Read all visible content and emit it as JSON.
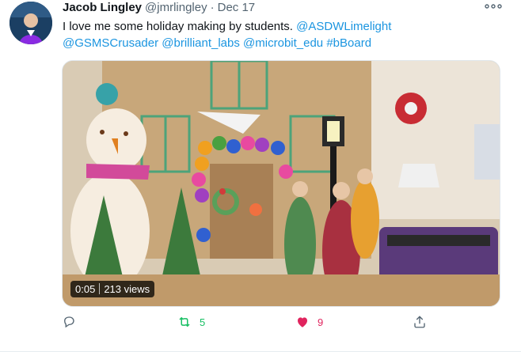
{
  "author": {
    "display_name": "Jacob Lingley",
    "handle": "@jmrlingley",
    "separator": "·",
    "date": "Dec 17"
  },
  "tweet": {
    "text_intro": "I love me some holiday making by students.",
    "mentions": [
      "@ASDWLimelight",
      "@GSMSCrusader",
      "@brilliant_labs",
      "@microbit_edu",
      "#bBoard"
    ]
  },
  "media": {
    "duration": "0:05",
    "views": "213 views"
  },
  "actions": {
    "retweet_count": "5",
    "like_count": "9"
  },
  "colors": {
    "link": "#1b95e0",
    "retweet": "#17bf63",
    "like": "#e0245e",
    "muted": "#536471"
  },
  "icons": {
    "more": "more-icon",
    "reply": "reply-icon",
    "retweet": "retweet-icon",
    "like": "heart-icon",
    "share": "share-icon"
  }
}
